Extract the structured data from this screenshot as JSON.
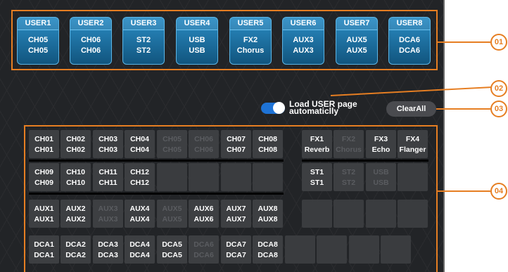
{
  "user_buttons": [
    {
      "label": "USER1",
      "line1": "CH05",
      "line2": "CH05"
    },
    {
      "label": "USER2",
      "line1": "CH06",
      "line2": "CH06"
    },
    {
      "label": "USER3",
      "line1": "ST2",
      "line2": "ST2"
    },
    {
      "label": "USER4",
      "line1": "USB",
      "line2": "USB"
    },
    {
      "label": "USER5",
      "line1": "FX2",
      "line2": "Chorus"
    },
    {
      "label": "USER6",
      "line1": "AUX3",
      "line2": "AUX3"
    },
    {
      "label": "USER7",
      "line1": "AUX5",
      "line2": "AUX5"
    },
    {
      "label": "USER8",
      "line1": "DCA6",
      "line2": "DCA6"
    }
  ],
  "toggle": {
    "label": "Load USER page automaticlly",
    "on": true
  },
  "clear_all": "ClearAll",
  "channels": {
    "row1": [
      {
        "a": "CH01",
        "b": "CH01",
        "dim": false
      },
      {
        "a": "CH02",
        "b": "CH02",
        "dim": false
      },
      {
        "a": "CH03",
        "b": "CH03",
        "dim": false
      },
      {
        "a": "CH04",
        "b": "CH04",
        "dim": false
      },
      {
        "a": "CH05",
        "b": "CH05",
        "dim": true
      },
      {
        "a": "CH06",
        "b": "CH06",
        "dim": true
      },
      {
        "a": "CH07",
        "b": "CH07",
        "dim": false
      },
      {
        "a": "CH08",
        "b": "CH08",
        "dim": false
      }
    ],
    "row2": [
      {
        "a": "CH09",
        "b": "CH09",
        "dim": false
      },
      {
        "a": "CH10",
        "b": "CH10",
        "dim": false
      },
      {
        "a": "CH11",
        "b": "CH11",
        "dim": false
      },
      {
        "a": "CH12",
        "b": "CH12",
        "dim": false
      }
    ],
    "row3": [
      {
        "a": "AUX1",
        "b": "AUX1",
        "dim": false
      },
      {
        "a": "AUX2",
        "b": "AUX2",
        "dim": false
      },
      {
        "a": "AUX3",
        "b": "AUX3",
        "dim": true
      },
      {
        "a": "AUX4",
        "b": "AUX4",
        "dim": false
      },
      {
        "a": "AUX5",
        "b": "AUX5",
        "dim": true
      },
      {
        "a": "AUX6",
        "b": "AUX6",
        "dim": false
      },
      {
        "a": "AUX7",
        "b": "AUX7",
        "dim": false
      },
      {
        "a": "AUX8",
        "b": "AUX8",
        "dim": false
      }
    ],
    "row4": [
      {
        "a": "DCA1",
        "b": "DCA1",
        "dim": false
      },
      {
        "a": "DCA2",
        "b": "DCA2",
        "dim": false
      },
      {
        "a": "DCA3",
        "b": "DCA3",
        "dim": false
      },
      {
        "a": "DCA4",
        "b": "DCA4",
        "dim": false
      },
      {
        "a": "DCA5",
        "b": "DCA5",
        "dim": false
      },
      {
        "a": "DCA6",
        "b": "DCA6",
        "dim": true
      },
      {
        "a": "DCA7",
        "b": "DCA7",
        "dim": false
      },
      {
        "a": "DCA8",
        "b": "DCA8",
        "dim": false
      }
    ],
    "fx": [
      {
        "a": "FX1",
        "b": "Reverb",
        "dim": false
      },
      {
        "a": "FX2",
        "b": "Chorus",
        "dim": true
      },
      {
        "a": "FX3",
        "b": "Echo",
        "dim": false
      },
      {
        "a": "FX4",
        "b": "Flanger",
        "dim": false
      }
    ],
    "st": [
      {
        "a": "ST1",
        "b": "ST1",
        "dim": false
      },
      {
        "a": "ST2",
        "b": "ST2",
        "dim": true
      },
      {
        "a": "USB",
        "b": "USB",
        "dim": true
      }
    ]
  },
  "callouts": [
    "01",
    "02",
    "03",
    "04"
  ],
  "colors": {
    "accent": "#e67e22",
    "user_button": "#1a6fa3",
    "toggle_on": "#1e73d6"
  }
}
